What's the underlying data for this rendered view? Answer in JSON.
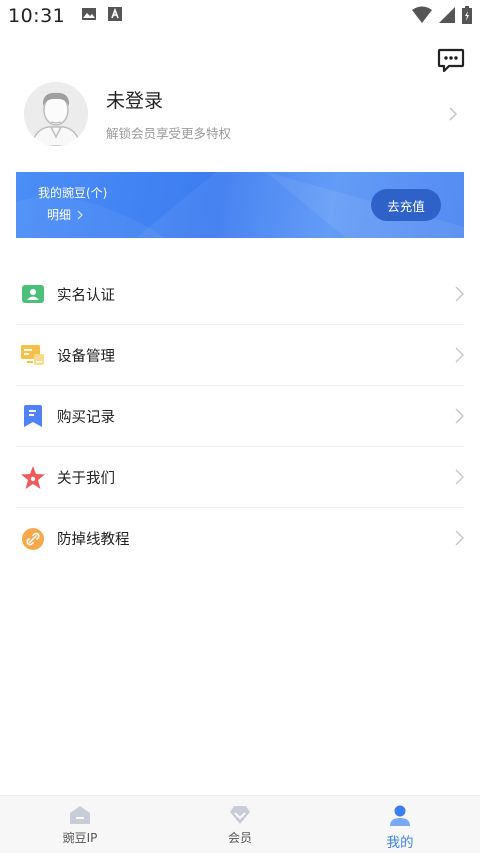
{
  "status_bar": {
    "time": "10:31"
  },
  "header": {
    "message_icon": "chat-bubble-icon"
  },
  "profile": {
    "name": "未登录",
    "subtitle": "解锁会员享受更多特权"
  },
  "banner": {
    "title": "我的豌豆(个)",
    "detail": "明细",
    "recharge_label": "去充值"
  },
  "menu": {
    "items": [
      {
        "label": "实名认证",
        "icon": "id-card-icon",
        "color": "#4cbf78"
      },
      {
        "label": "设备管理",
        "icon": "device-icon",
        "color": "#f5c04a"
      },
      {
        "label": "购买记录",
        "icon": "record-icon",
        "color": "#4f82f4"
      },
      {
        "label": "关于我们",
        "icon": "star-icon",
        "color": "#f05a5a"
      },
      {
        "label": "防掉线教程",
        "icon": "link-icon",
        "color": "#f6a84a"
      }
    ]
  },
  "bottom_nav": {
    "items": [
      {
        "label": "豌豆IP",
        "icon": "home-icon",
        "active": false
      },
      {
        "label": "会员",
        "icon": "diamond-icon",
        "active": false
      },
      {
        "label": "我的",
        "icon": "person-icon",
        "active": true
      }
    ]
  },
  "colors": {
    "accent": "#3d7ef0",
    "banner": "#4b8ef7",
    "recharge_button": "#2f62c9"
  }
}
